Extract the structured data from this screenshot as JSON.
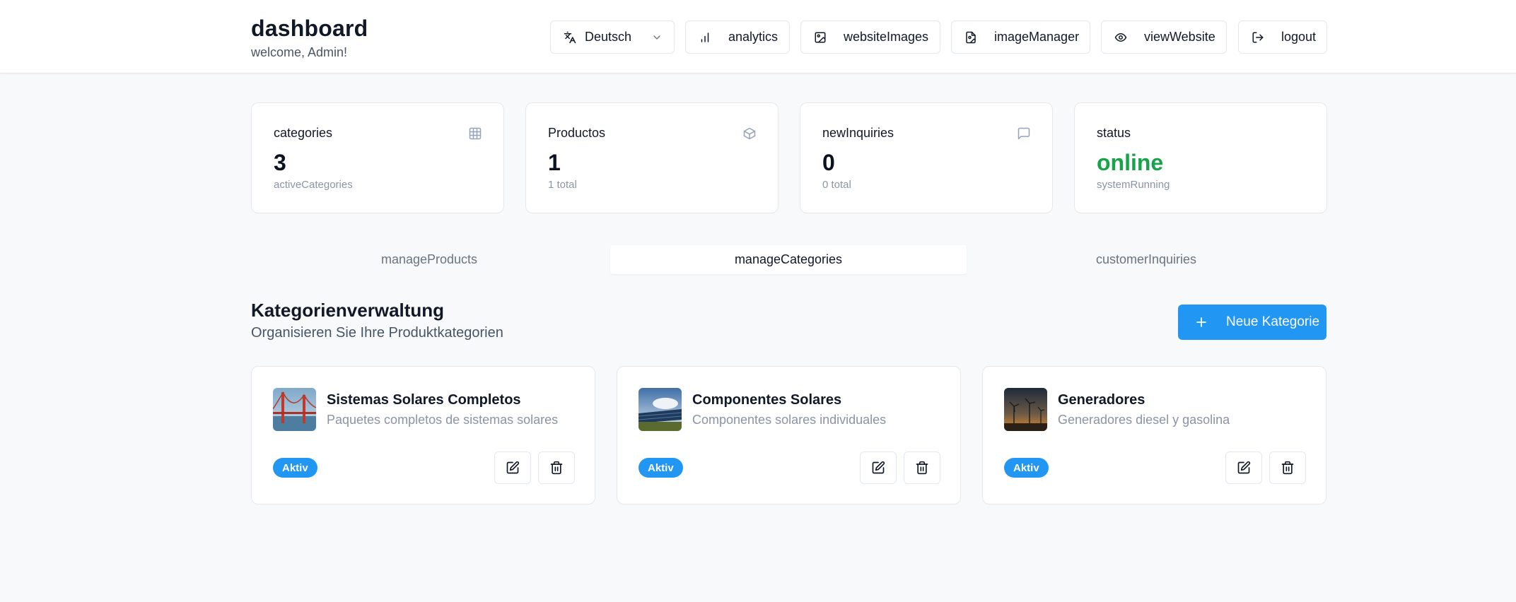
{
  "header": {
    "title": "dashboard",
    "subtitle": "welcome, Admin!",
    "language": "Deutsch",
    "buttons": {
      "analytics": "analytics",
      "website_images": "websiteImages",
      "image_manager": "imageManager",
      "view_website": "viewWebsite",
      "logout": "logout"
    }
  },
  "stats": [
    {
      "title": "categories",
      "value": "3",
      "sub": "activeCategories",
      "icon": "grid-icon"
    },
    {
      "title": "Productos",
      "value": "1",
      "sub": "1 total",
      "icon": "package-icon"
    },
    {
      "title": "newInquiries",
      "value": "0",
      "sub": "0 total",
      "icon": "message-icon"
    },
    {
      "title": "status",
      "value": "online",
      "sub": "systemRunning",
      "value_color": "#16a34a"
    }
  ],
  "tabs": [
    {
      "label": "manageProducts",
      "active": false
    },
    {
      "label": "manageCategories",
      "active": true
    },
    {
      "label": "customerInquiries",
      "active": false
    }
  ],
  "section": {
    "title": "Kategorienverwaltung",
    "subtitle": "Organisieren Sie Ihre Produktkategorien",
    "new_button": "Neue Kategorie"
  },
  "categories": [
    {
      "name": "Sistemas Solares Completos",
      "description": "Paquetes completos de sistemas solares",
      "status": "Aktiv"
    },
    {
      "name": "Componentes Solares",
      "description": "Componentes solares individuales",
      "status": "Aktiv"
    },
    {
      "name": "Generadores",
      "description": "Generadores diesel y gasolina",
      "status": "Aktiv"
    }
  ],
  "colors": {
    "accent": "#2196f3",
    "online": "#16a34a",
    "background": "#f8f9fb"
  }
}
